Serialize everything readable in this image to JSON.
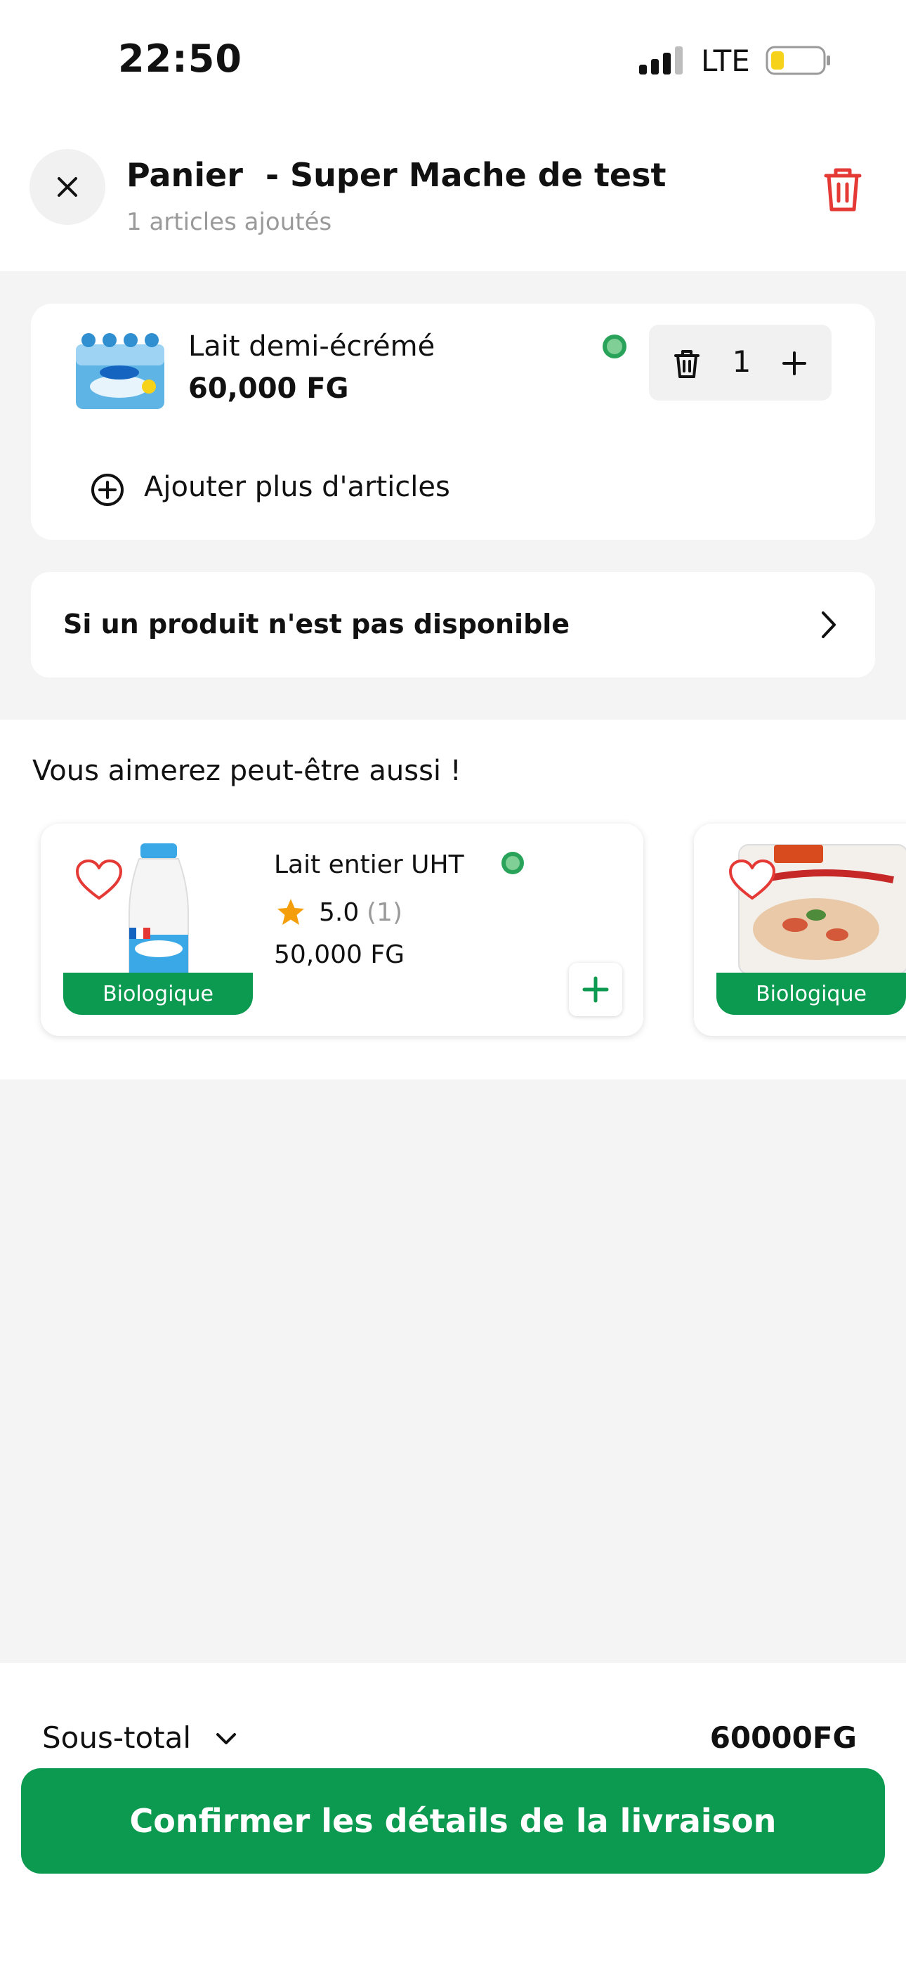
{
  "status_bar": {
    "time": "22:50",
    "network": "LTE"
  },
  "header": {
    "title": "Panier  - Super Mache de test",
    "subtitle": "1 articles ajoutés",
    "icons": [
      "close-icon",
      "trash-icon"
    ]
  },
  "cart": {
    "items": [
      {
        "name": "Lait demi-écrémé",
        "price": "60,000 FG",
        "quantity": "1"
      }
    ],
    "add_more_label": "Ajouter plus d'articles"
  },
  "unavailable": {
    "label": "Si un produit n'est pas disponible"
  },
  "recommendations": {
    "title": "Vous aimerez peut-être aussi !",
    "items": [
      {
        "name": "Lait entier UHT",
        "rating": "5.0",
        "rating_count": "(1)",
        "price": "50,000 FG",
        "badge": "Biologique"
      },
      {
        "badge": "Biologique"
      }
    ]
  },
  "footer": {
    "subtotal_label": "Sous-total",
    "subtotal_value": "60000FG",
    "confirm_label": "Confirmer les détails de la livraison"
  },
  "colors": {
    "accent_green": "#0c9a50",
    "danger_red": "#e53935",
    "star_orange": "#f59e0b"
  }
}
